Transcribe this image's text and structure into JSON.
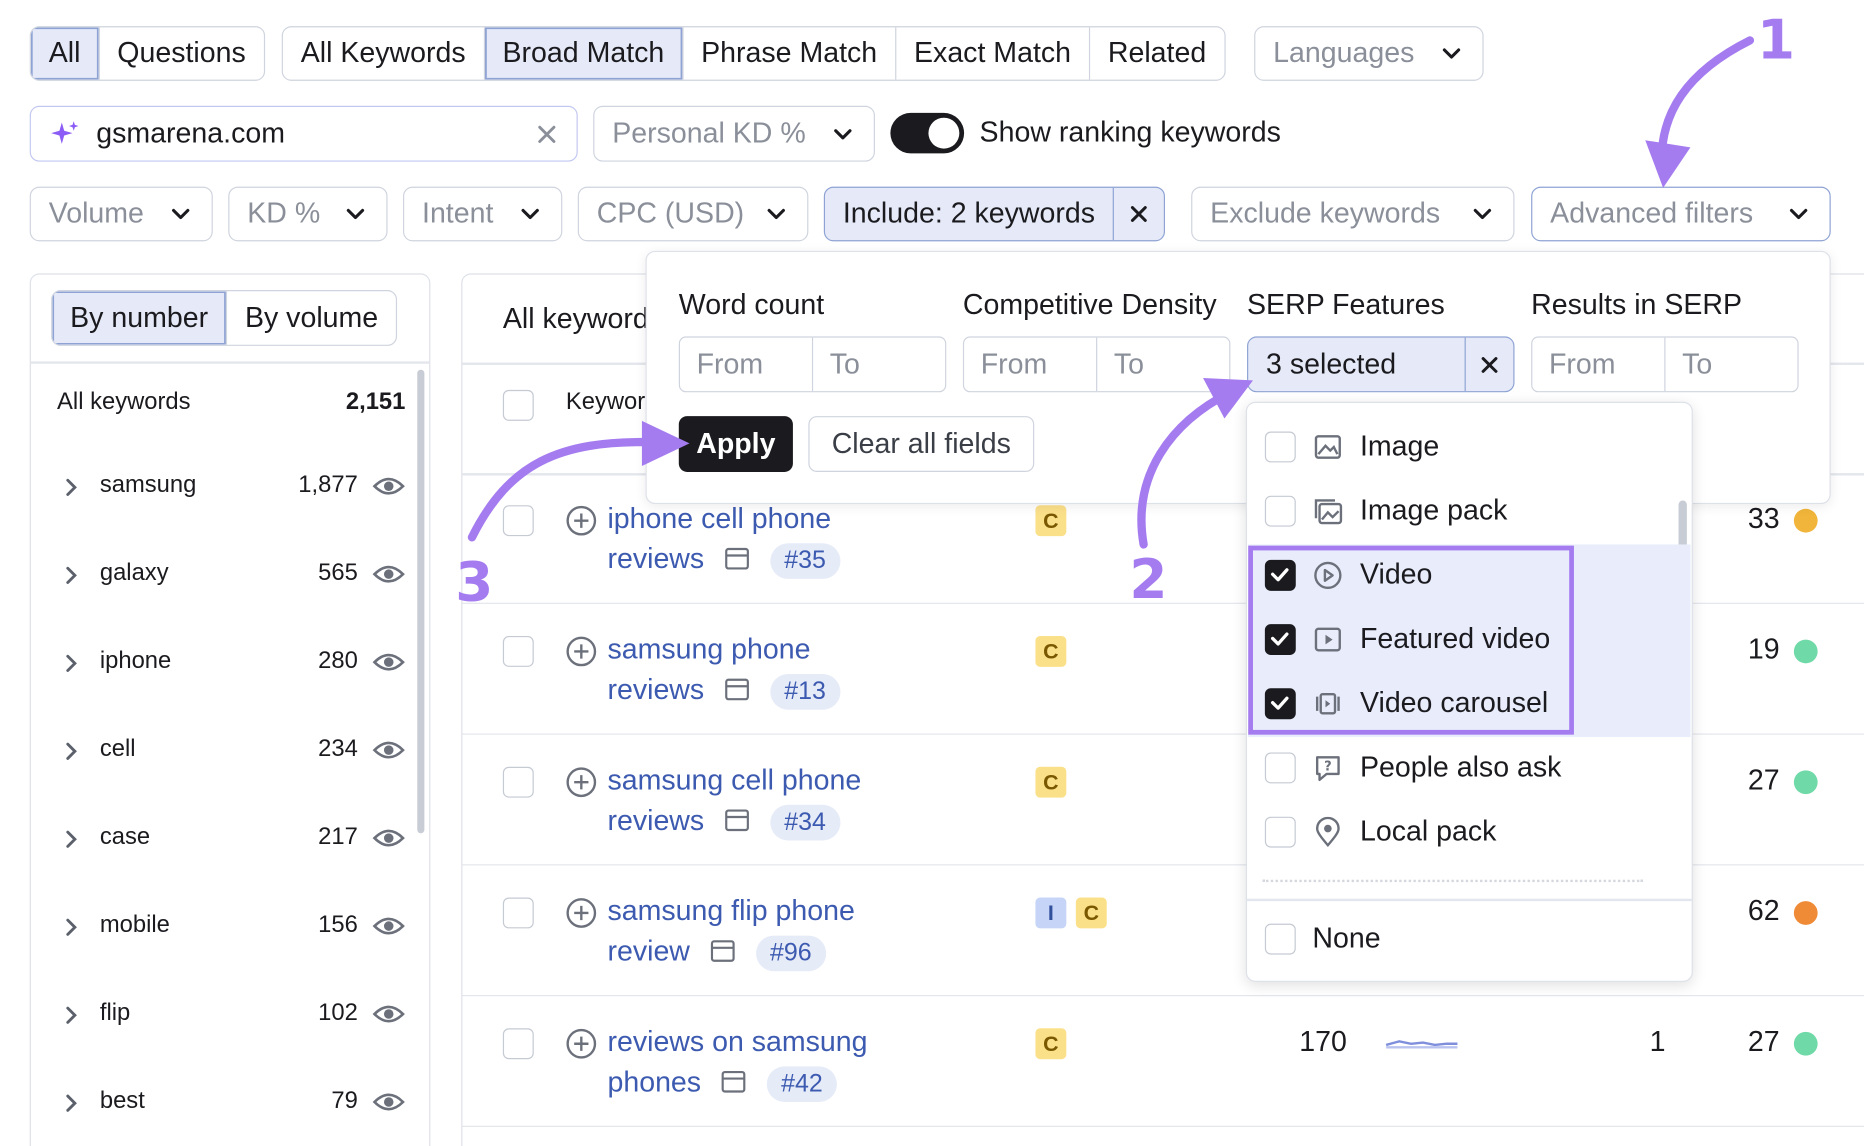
{
  "tabs": {
    "group1": [
      "All",
      "Questions"
    ],
    "group2": [
      "All Keywords",
      "Broad Match",
      "Phrase Match",
      "Exact Match",
      "Related"
    ],
    "languages": "Languages"
  },
  "search": {
    "value": "gsmarena.com",
    "personal_kd": "Personal KD %",
    "show_ranking": "Show ranking keywords"
  },
  "filters": {
    "volume": "Volume",
    "kd": "KD %",
    "intent": "Intent",
    "cpc": "CPC (USD)",
    "include": "Include: 2 keywords",
    "exclude": "Exclude keywords",
    "advanced": "Advanced filters"
  },
  "sidebar": {
    "by_number": "By number",
    "by_volume": "By volume",
    "all_label": "All keywords",
    "all_count": "2,151",
    "groups": [
      {
        "name": "samsung",
        "count": "1,877"
      },
      {
        "name": "galaxy",
        "count": "565"
      },
      {
        "name": "iphone",
        "count": "280"
      },
      {
        "name": "cell",
        "count": "234"
      },
      {
        "name": "case",
        "count": "217"
      },
      {
        "name": "mobile",
        "count": "156"
      },
      {
        "name": "flip",
        "count": "102"
      },
      {
        "name": "best",
        "count": "79"
      }
    ]
  },
  "table": {
    "title": "All keyword",
    "col_keyword": "Keywor",
    "rows": [
      {
        "l1": "iphone cell phone",
        "l2": "reviews",
        "rank": "#35",
        "kd": "33",
        "color": "#f0b53a"
      },
      {
        "l1": "samsung phone",
        "l2": "reviews",
        "rank": "#13",
        "kd": "19",
        "color": "#6fd9a8"
      },
      {
        "l1": "samsung cell phone",
        "l2": "reviews",
        "rank": "#34",
        "kd": "27",
        "color": "#6fd9a8"
      },
      {
        "l1": "samsung flip phone",
        "l2": "review",
        "rank": "#96",
        "kd": "62",
        "color": "#ef8a36"
      },
      {
        "l1": "reviews on samsung",
        "l2": "phones",
        "rank": "#42",
        "kd": "27",
        "color": "#6fd9a8",
        "volume": "170",
        "results": "1"
      }
    ],
    "intent_c": "C",
    "intent_i": "I"
  },
  "advanced_panel": {
    "word_count": "Word count",
    "competitive_density": "Competitive Density",
    "serp_features": "SERP Features",
    "results_in_serp": "Results in SERP",
    "from": "From",
    "to": "To",
    "serp_selected": "3 selected",
    "apply": "Apply",
    "clear_all": "Clear all fields",
    "options": [
      "Image",
      "Image pack",
      "Video",
      "Featured video",
      "Video carousel",
      "People also ask",
      "Local pack"
    ],
    "none": "None"
  },
  "annotations": {
    "step1": "1",
    "step2": "2",
    "step3": "3"
  },
  "colors": {
    "annotation": "#a57cf0",
    "active_tab": "#e6eaf8",
    "link": "#3c5ab0"
  }
}
